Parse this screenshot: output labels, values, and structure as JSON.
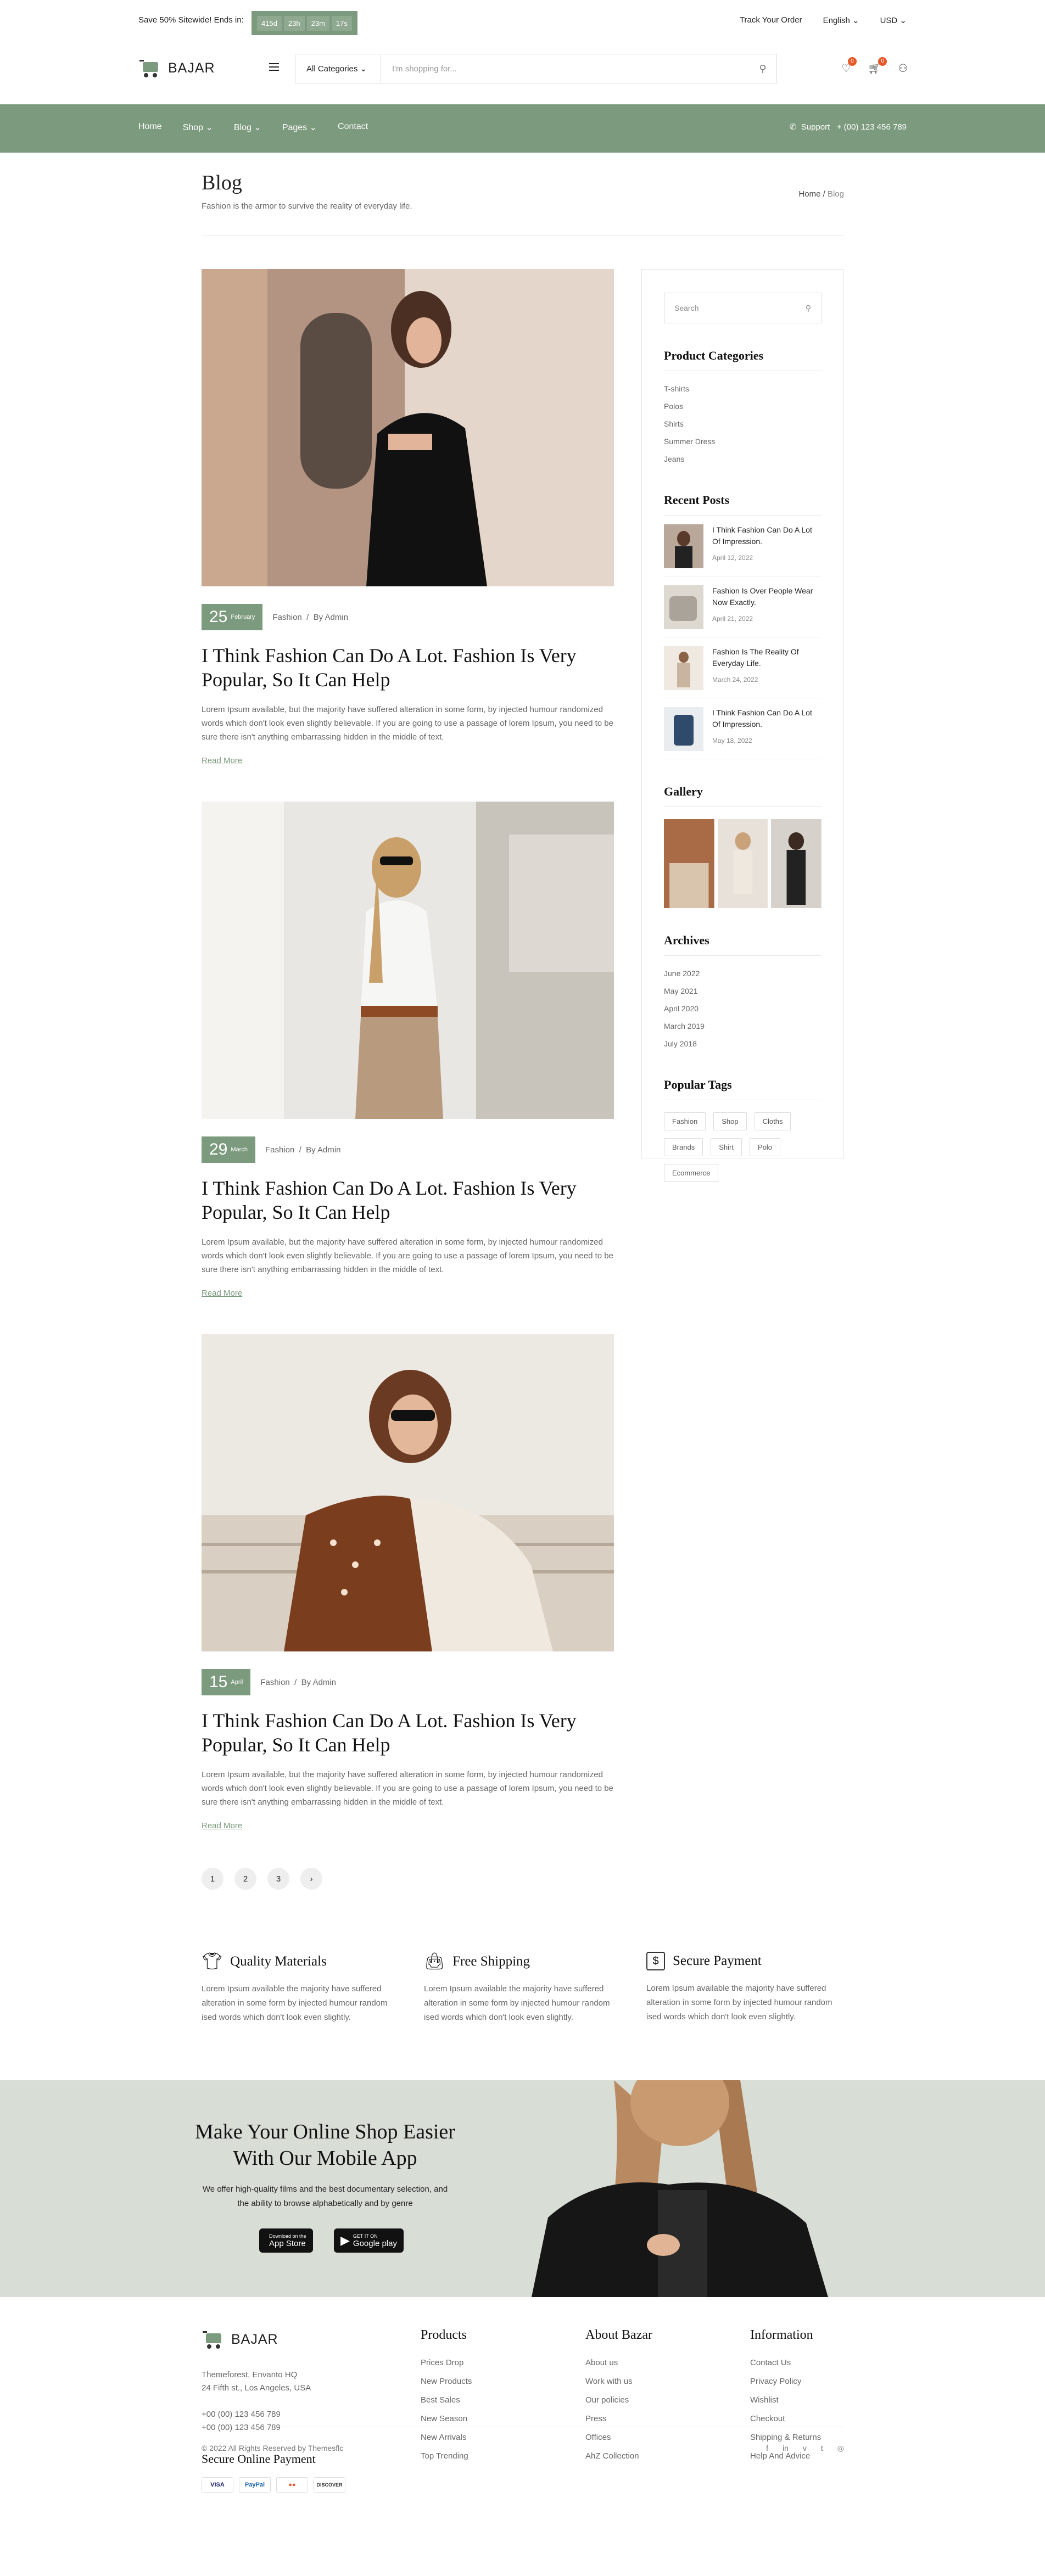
{
  "topbar": {
    "promo": "Save 50% Sitewide! Ends in:",
    "timer": [
      "415d",
      "23h",
      "23m",
      "17s"
    ],
    "track": "Track Your Order",
    "language": "English",
    "currency": "USD"
  },
  "header": {
    "logo": "BAJAR",
    "category": "All Categories",
    "search_placeholder": "I'm shopping for...",
    "wishlist_count": "0",
    "cart_count": "0"
  },
  "nav": {
    "items": [
      "Home",
      "Shop",
      "Blog",
      "Pages",
      "Contact"
    ],
    "support_label": "Support",
    "support_phone": "+ (00) 123 456 789"
  },
  "page": {
    "title": "Blog",
    "subtitle": "Fashion is the armor to survive the reality of everyday life.",
    "breadcrumb_home": "Home",
    "breadcrumb_current": "Blog"
  },
  "posts": [
    {
      "day": "25",
      "month": "February",
      "category": "Fashion",
      "author": "By Admin",
      "title": "I Think Fashion Can Do A Lot. Fashion Is Very Popular, So It Can Help",
      "excerpt": "Lorem Ipsum available, but the majority have suffered alteration in some form, by injected humour randomized words which don't look even slightly believable. If you are going to use a passage of lorem Ipsum, you need to be sure there isn't anything embarrassing hidden in the middle of text.",
      "read_more": "Read More"
    },
    {
      "day": "29",
      "month": "March",
      "category": "Fashion",
      "author": "By Admin",
      "title": "I Think Fashion Can Do A Lot. Fashion Is Very Popular, So It Can Help",
      "excerpt": "Lorem Ipsum available, but the majority have suffered alteration in some form, by injected humour randomized words which don't look even slightly believable. If you are going to use a passage of lorem Ipsum, you need to be sure there isn't anything embarrassing hidden in the middle of text.",
      "read_more": "Read More"
    },
    {
      "day": "15",
      "month": "April",
      "category": "Fashion",
      "author": "By Admin",
      "title": "I Think Fashion Can Do A Lot. Fashion Is Very Popular, So It Can Help",
      "excerpt": "Lorem Ipsum available, but the majority have suffered alteration in some form, by injected humour randomized words which don't look even slightly believable. If you are going to use a passage of lorem Ipsum, you need to be sure there isn't anything embarrassing hidden in the middle of text.",
      "read_more": "Read More"
    }
  ],
  "pagination": [
    "1",
    "2",
    "3",
    "›"
  ],
  "sidebar": {
    "search_placeholder": "Search",
    "categories_title": "Product Categories",
    "categories": [
      "T-shirts",
      "Polos",
      "Shirts",
      "Summer Dress",
      "Jeans"
    ],
    "recent_title": "Recent Posts",
    "recent": [
      {
        "title": "I Think Fashion Can Do A Lot Of Impression.",
        "date": "April 12, 2022"
      },
      {
        "title": "Fashion Is Over People Wear Now Exactly.",
        "date": "April 21, 2022"
      },
      {
        "title": "Fashion Is The Reality Of Everyday Life.",
        "date": "March 24, 2022"
      },
      {
        "title": "I Think Fashion Can Do A Lot Of Impression.",
        "date": "May 18, 2022"
      }
    ],
    "gallery_title": "Gallery",
    "archives_title": "Archives",
    "archives": [
      "June 2022",
      "May 2021",
      "April 2020",
      "March 2019",
      "July 2018"
    ],
    "tags_title": "Popular Tags",
    "tags": [
      "Fashion",
      "Shop",
      "Cloths",
      "Brands",
      "Shirt",
      "Polo",
      "Ecommerce"
    ]
  },
  "features": [
    {
      "title": "Quality Materials",
      "text": "Lorem Ipsum available the majority have suffered alteration in some form by injected humour random ised words which don't look even slightly."
    },
    {
      "title": "Free Shipping",
      "text": "Lorem Ipsum available the majority have suffered alteration in some form by injected humour random ised words which don't look even slightly."
    },
    {
      "title": "Secure Payment",
      "text": "Lorem Ipsum available the majority have suffered alteration in some form by injected humour random ised words which don't look even slightly."
    }
  ],
  "app": {
    "title": "Make Your Online Shop Easier With Our Mobile App",
    "text": "We offer high-quality films and the best documentary selection, and the ability to browse alphabetically and by genre",
    "appstore_small": "Download on the",
    "appstore": "App Store",
    "gplay_small": "GET IT ON",
    "gplay": "Google play"
  },
  "footer": {
    "logo": "BAJAR",
    "address1": "Themeforest, Envanto HQ",
    "address2": "24 Fifth st., Los Angeles, USA",
    "phone1": "+00 (00) 123 456 789",
    "phone2": "+00 (00) 123 456 789",
    "payment_title": "Secure Online Payment",
    "cards": [
      "VISA",
      "PayPal",
      "●●",
      "DISCOVER"
    ],
    "products_title": "Products",
    "products": [
      "Prices Drop",
      "New Products",
      "Best Sales",
      "New Season",
      "New Arrivals",
      "Top Trending"
    ],
    "about_title": "About Bazar",
    "about": [
      "About us",
      "Work with us",
      "Our policies",
      "Press",
      "Offices",
      "AhZ Collection"
    ],
    "info_title": "Information",
    "info": [
      "Contact Us",
      "Privacy Policy",
      "Wishlist",
      "Checkout",
      "Shipping & Returns",
      "Help And Advice"
    ],
    "copyright": "© 2022 All Rights Reserved by Themesflc",
    "social": [
      "f",
      "in",
      "v",
      "t",
      "◎"
    ]
  },
  "colors": {
    "accent": "#7c9a7d",
    "badge": "#e8572a",
    "app_bg": "#d8ddd6"
  }
}
